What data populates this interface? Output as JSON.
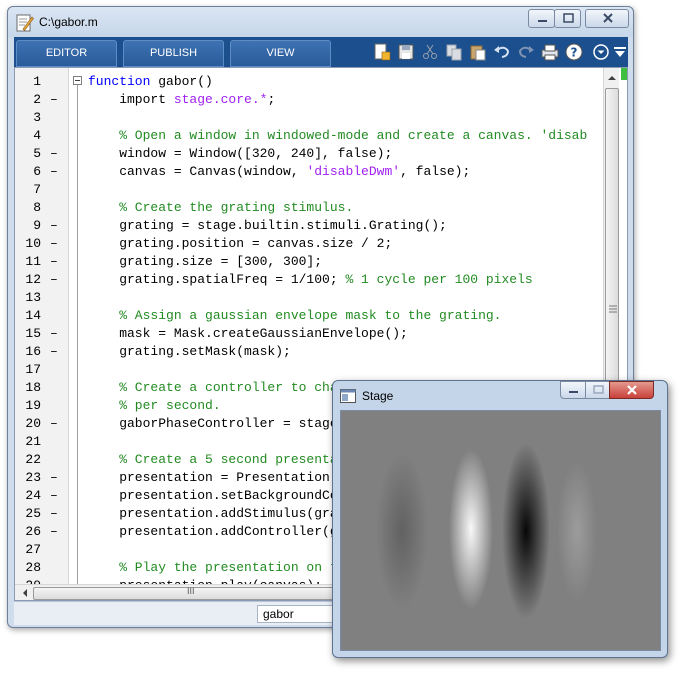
{
  "editor": {
    "title": "C:\\gabor.m",
    "tabs": [
      {
        "label": "EDITOR"
      },
      {
        "label": "PUBLISH"
      },
      {
        "label": "VIEW"
      }
    ],
    "status_filename": "gabor",
    "hscroll_grip": "III",
    "lines": [
      {
        "num": "1",
        "dash": "",
        "tokens": [
          {
            "t": "kw",
            "s": "function"
          },
          {
            "t": "pln",
            "s": " gabor()"
          }
        ],
        "indent": false
      },
      {
        "num": "2",
        "dash": "–",
        "tokens": [
          {
            "t": "pln",
            "s": "    import "
          },
          {
            "t": "str",
            "s": "stage.core.*"
          },
          {
            "t": "pln",
            "s": ";"
          }
        ]
      },
      {
        "num": "3",
        "dash": "",
        "tokens": []
      },
      {
        "num": "4",
        "dash": "",
        "tokens": [
          {
            "t": "cmt",
            "s": "    % Open a window in windowed-mode and create a canvas. 'disab"
          }
        ]
      },
      {
        "num": "5",
        "dash": "–",
        "tokens": [
          {
            "t": "pln",
            "s": "    window = Window([320, 240], false);"
          }
        ]
      },
      {
        "num": "6",
        "dash": "–",
        "tokens": [
          {
            "t": "pln",
            "s": "    canvas = Canvas(window, "
          },
          {
            "t": "str",
            "s": "'disableDwm'"
          },
          {
            "t": "pln",
            "s": ", false);"
          }
        ]
      },
      {
        "num": "7",
        "dash": "",
        "tokens": []
      },
      {
        "num": "8",
        "dash": "",
        "tokens": [
          {
            "t": "cmt",
            "s": "    % Create the grating stimulus."
          }
        ]
      },
      {
        "num": "9",
        "dash": "–",
        "tokens": [
          {
            "t": "pln",
            "s": "    grating = stage.builtin.stimuli.Grating();"
          }
        ]
      },
      {
        "num": "10",
        "dash": "–",
        "tokens": [
          {
            "t": "pln",
            "s": "    grating.position = canvas.size / 2;"
          }
        ]
      },
      {
        "num": "11",
        "dash": "–",
        "tokens": [
          {
            "t": "pln",
            "s": "    grating.size = [300, 300];"
          }
        ]
      },
      {
        "num": "12",
        "dash": "–",
        "tokens": [
          {
            "t": "pln",
            "s": "    grating.spatialFreq = 1/100; "
          },
          {
            "t": "cmt",
            "s": "% 1 cycle per 100 pixels"
          }
        ]
      },
      {
        "num": "13",
        "dash": "",
        "tokens": []
      },
      {
        "num": "14",
        "dash": "",
        "tokens": [
          {
            "t": "cmt",
            "s": "    % Assign a gaussian envelope mask to the grating."
          }
        ]
      },
      {
        "num": "15",
        "dash": "–",
        "tokens": [
          {
            "t": "pln",
            "s": "    mask = Mask.createGaussianEnvelope();"
          }
        ]
      },
      {
        "num": "16",
        "dash": "–",
        "tokens": [
          {
            "t": "pln",
            "s": "    grating.setMask(mask);"
          }
        ]
      },
      {
        "num": "17",
        "dash": "",
        "tokens": []
      },
      {
        "num": "18",
        "dash": "",
        "tokens": [
          {
            "t": "cmt",
            "s": "    % Create a controller to change the grating's phase propert"
          }
        ]
      },
      {
        "num": "19",
        "dash": "",
        "tokens": [
          {
            "t": "cmt",
            "s": "    % per second."
          }
        ]
      },
      {
        "num": "20",
        "dash": "–",
        "tokens": [
          {
            "t": "pln",
            "s": "    gaborPhaseController = stage"
          }
        ]
      },
      {
        "num": "21",
        "dash": "",
        "tokens": []
      },
      {
        "num": "22",
        "dash": "",
        "tokens": [
          {
            "t": "cmt",
            "s": "    % Create a 5 second presenta"
          }
        ]
      },
      {
        "num": "23",
        "dash": "–",
        "tokens": [
          {
            "t": "pln",
            "s": "    presentation = Presentation"
          }
        ]
      },
      {
        "num": "24",
        "dash": "–",
        "tokens": [
          {
            "t": "pln",
            "s": "    presentation.setBackgroundCo"
          }
        ]
      },
      {
        "num": "25",
        "dash": "–",
        "tokens": [
          {
            "t": "pln",
            "s": "    presentation.addStimulus(gra"
          }
        ]
      },
      {
        "num": "26",
        "dash": "–",
        "tokens": [
          {
            "t": "pln",
            "s": "    presentation.addController(g"
          }
        ]
      },
      {
        "num": "27",
        "dash": "",
        "tokens": []
      },
      {
        "num": "28",
        "dash": "",
        "tokens": [
          {
            "t": "cmt",
            "s": "    % Play the presentation on t"
          }
        ]
      },
      {
        "num": "29",
        "dash": "–",
        "tokens": [
          {
            "t": "pln",
            "s": "    presentation.play(canvas);"
          }
        ]
      }
    ]
  },
  "stage": {
    "title": "Stage"
  },
  "colors": {
    "keyword": "#0000ff",
    "string": "#a020f0",
    "comment": "#228b22",
    "toolstrip": "#1b4f8e",
    "close_button": "#c9403a"
  },
  "toolbar_icons": [
    "new-file-icon",
    "save-icon",
    "cut-icon",
    "copy-icon",
    "paste-icon",
    "undo-icon",
    "redo-icon",
    "print-icon",
    "help-icon",
    "expand-icon",
    "dock-menu-icon"
  ]
}
